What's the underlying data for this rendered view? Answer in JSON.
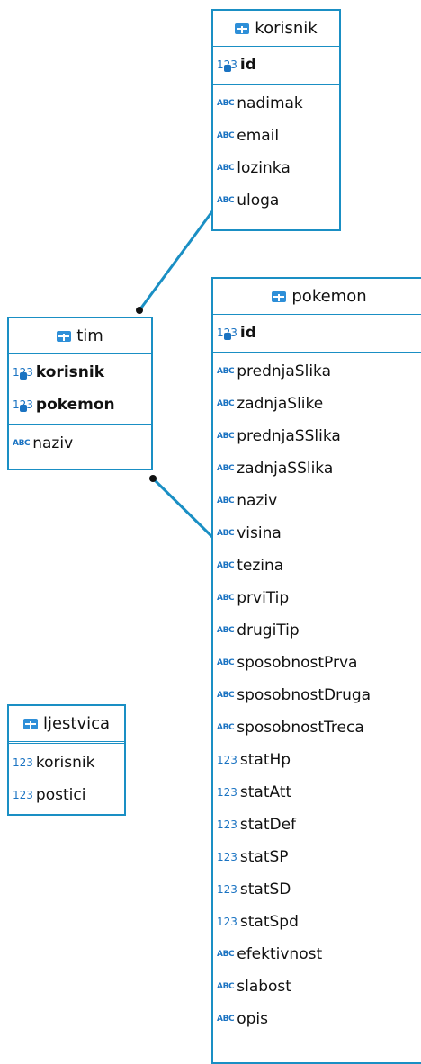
{
  "entities": {
    "korisnik": {
      "name": "korisnik",
      "key_columns": [
        {
          "name": "id",
          "type": "123"
        }
      ],
      "columns": [
        {
          "name": "nadimak",
          "type": "ABC"
        },
        {
          "name": "email",
          "type": "ABC"
        },
        {
          "name": "lozinka",
          "type": "ABC"
        },
        {
          "name": "uloga",
          "type": "ABC"
        }
      ]
    },
    "tim": {
      "name": "tim",
      "key_columns": [
        {
          "name": "korisnik",
          "type": "123"
        },
        {
          "name": "pokemon",
          "type": "123"
        }
      ],
      "columns": [
        {
          "name": "naziv",
          "type": "ABC"
        }
      ]
    },
    "ljestvica": {
      "name": "ljestvica",
      "key_columns": [],
      "columns": [
        {
          "name": "korisnik",
          "type": "123"
        },
        {
          "name": "postici",
          "type": "123"
        }
      ]
    },
    "pokemon": {
      "name": "pokemon",
      "key_columns": [
        {
          "name": "id",
          "type": "123"
        }
      ],
      "columns": [
        {
          "name": "prednjaSlika",
          "type": "ABC"
        },
        {
          "name": "zadnjaSlike",
          "type": "ABC"
        },
        {
          "name": "prednjaSSlika",
          "type": "ABC"
        },
        {
          "name": "zadnjaSSlika",
          "type": "ABC"
        },
        {
          "name": "naziv",
          "type": "ABC"
        },
        {
          "name": "visina",
          "type": "ABC"
        },
        {
          "name": "tezina",
          "type": "ABC"
        },
        {
          "name": "prviTip",
          "type": "ABC"
        },
        {
          "name": "drugiTip",
          "type": "ABC"
        },
        {
          "name": "sposobnostPrva",
          "type": "ABC"
        },
        {
          "name": "sposobnostDruga",
          "type": "ABC"
        },
        {
          "name": "sposobnostTreca",
          "type": "ABC"
        },
        {
          "name": "statHp",
          "type": "123"
        },
        {
          "name": "statAtt",
          "type": "123"
        },
        {
          "name": "statDef",
          "type": "123"
        },
        {
          "name": "statSP",
          "type": "123"
        },
        {
          "name": "statSD",
          "type": "123"
        },
        {
          "name": "statSpd",
          "type": "123"
        },
        {
          "name": "efektivnost",
          "type": "ABC"
        },
        {
          "name": "slabost",
          "type": "ABC"
        },
        {
          "name": "opis",
          "type": "ABC"
        }
      ]
    }
  },
  "relationships": [
    {
      "from": "tim",
      "to": "korisnik"
    },
    {
      "from": "tim",
      "to": "pokemon"
    }
  ],
  "colors": {
    "border": "#1a8fc4",
    "icon": "#1a73c2"
  }
}
